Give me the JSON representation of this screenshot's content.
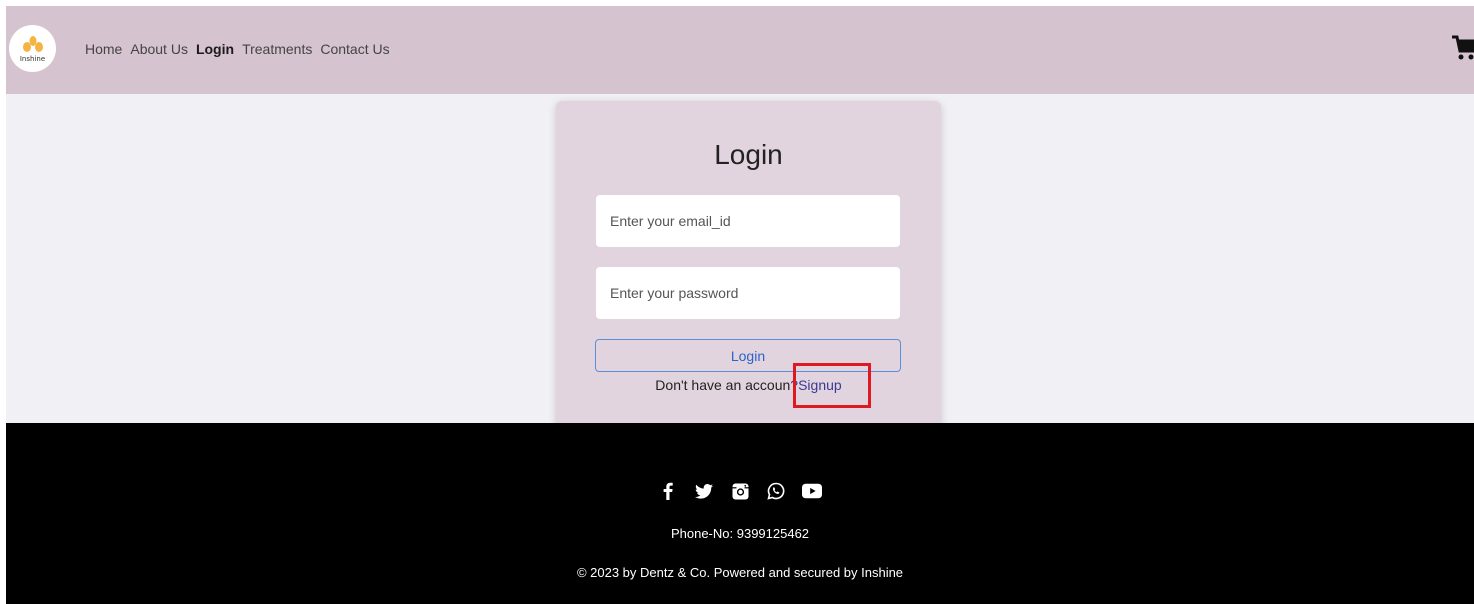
{
  "navbar": {
    "logo_text": "Inshine",
    "links": [
      "Home",
      "About Us",
      "Login",
      "Treatments",
      "Contact Us"
    ],
    "active_index": 2,
    "cart_icon": "shopping-cart-icon"
  },
  "login": {
    "title": "Login",
    "email_placeholder": "Enter your email_id",
    "password_placeholder": "Enter your password",
    "button_label": "Login",
    "signup_prompt": "Don't have an accoun",
    "signup_link": "?Signup"
  },
  "footer": {
    "social_icons": [
      "facebook-icon",
      "twitter-icon",
      "instagram-icon",
      "whatsapp-icon",
      "youtube-icon"
    ],
    "phone": "Phone-No: 9399125462",
    "copyright": "© 2023 by Dentz & Co. Powered and secured by Inshine"
  },
  "colors": {
    "navbar_bg": "#d6c3d0",
    "card_bg": "#e2d4df",
    "page_bg": "#f1f0f4",
    "footer_bg": "#000000",
    "button_border": "#5b8fd8",
    "highlight": "#e0181f",
    "logo_accent": "#f5b342"
  }
}
